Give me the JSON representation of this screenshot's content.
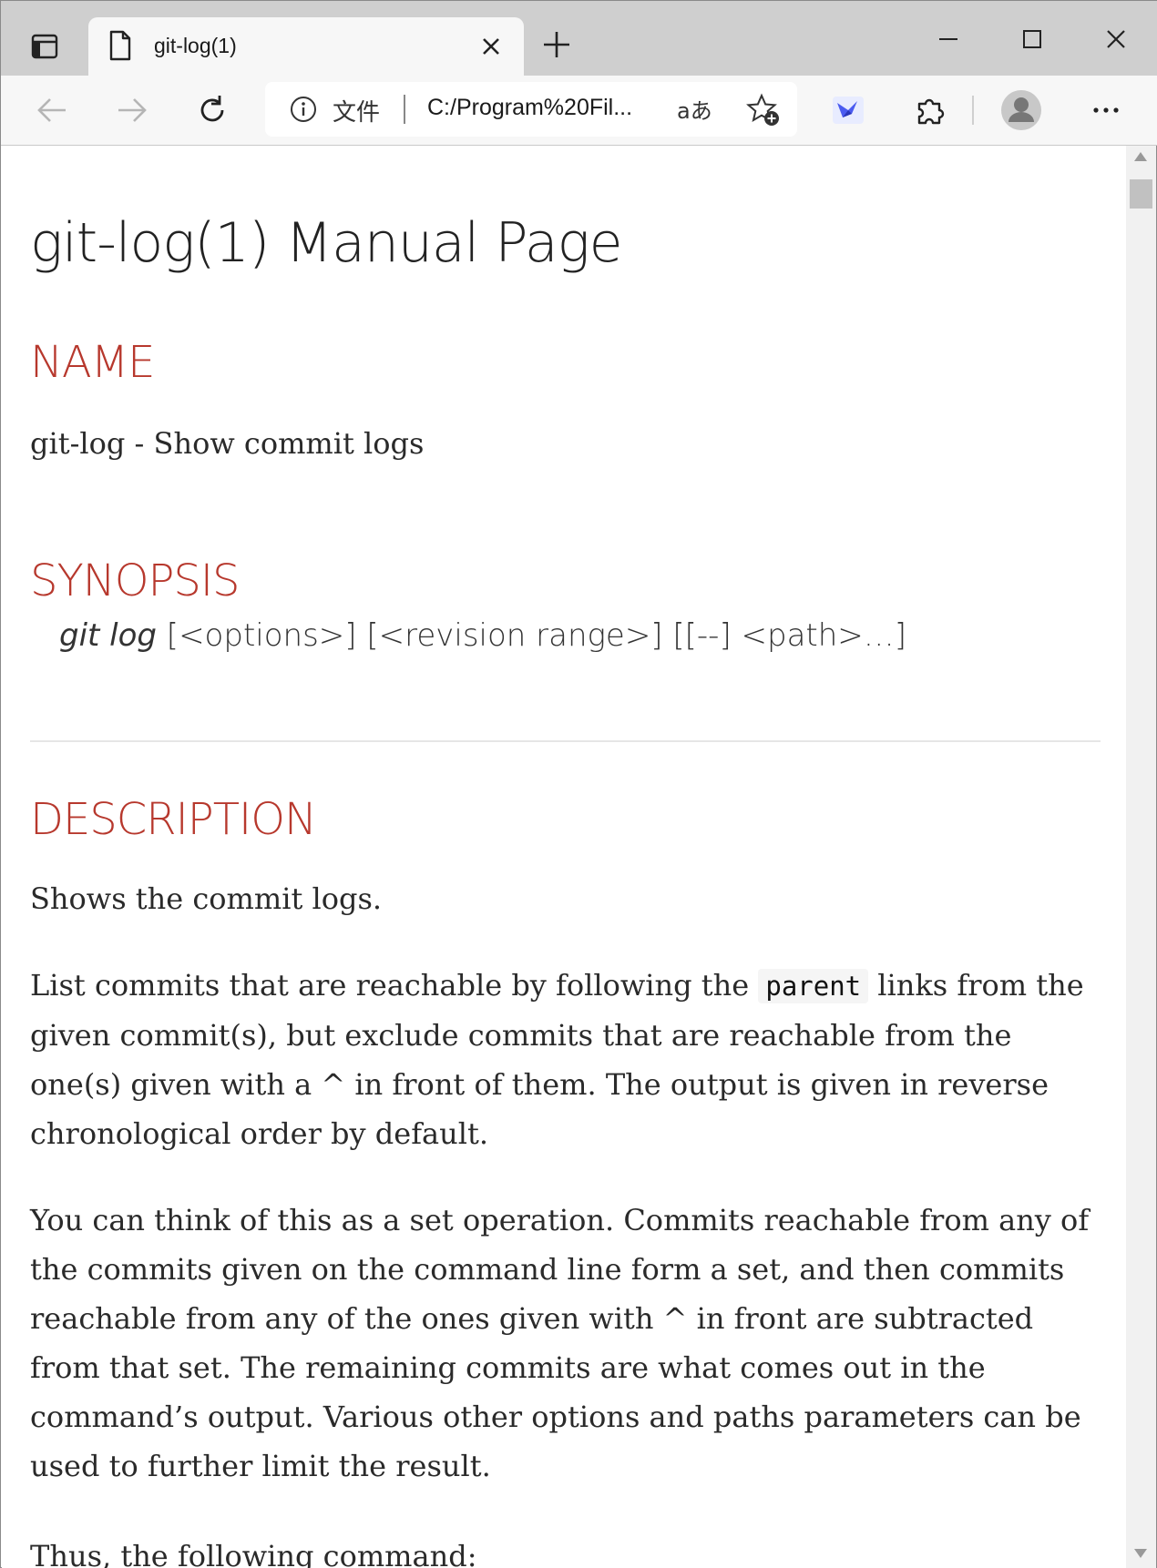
{
  "browser": {
    "tab_title": "git-log(1)",
    "address_label": "文件",
    "url": "C:/Program%20Fil...",
    "read_aloud_label": "aあ"
  },
  "page": {
    "title": "git-log(1) Manual Page",
    "name_heading": "NAME",
    "name_text": "git-log - Show commit logs",
    "synopsis_heading": "SYNOPSIS",
    "synopsis_cmd": "git log",
    "synopsis_args": " [<options>] [<revision range>] [[--] <path>…]",
    "description_heading": "DESCRIPTION",
    "desc_p1": "Shows the commit logs.",
    "desc_p2_before": "List commits that are reachable by following the ",
    "desc_p2_code": "parent",
    "desc_p2_after": " links from the given commit(s), but exclude commits that are reachable from the one(s) given with a ^ in front of them. The output is given in reverse chronological order by default.",
    "desc_p3": "You can think of this as a set operation. Commits reachable from any of the commits given on the command line form a set, and then commits reachable from any of the ones given with ^ in front are subtracted from that set. The remaining commits are what comes out in the command’s output. Various other options and paths parameters can be used to further limit the result.",
    "desc_p4": "Thus, the following command:"
  }
}
